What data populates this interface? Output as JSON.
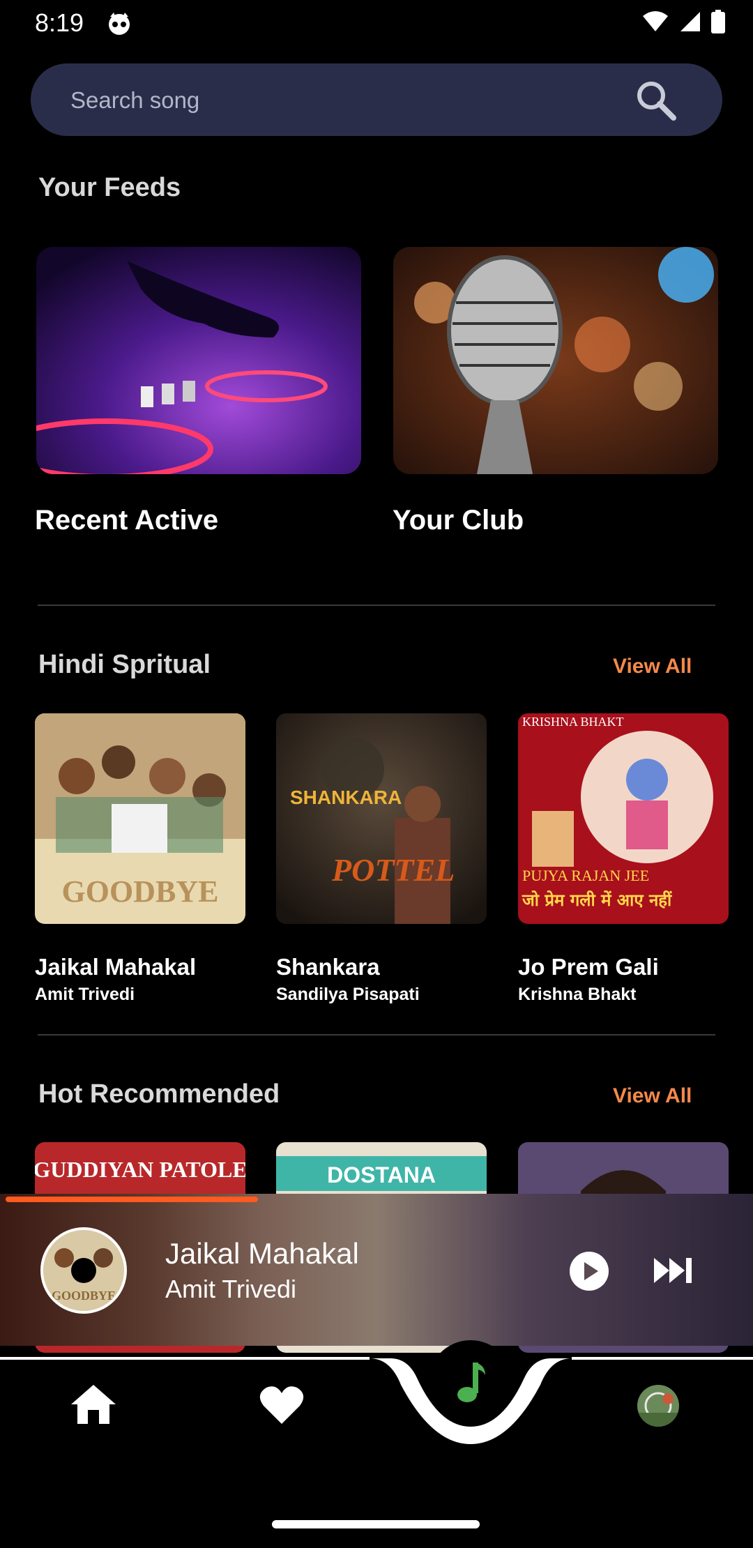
{
  "status_bar": {
    "time": "8:19"
  },
  "search": {
    "placeholder": "Search song"
  },
  "feeds": {
    "title": "Your Feeds",
    "cards": [
      {
        "label": "Recent Active"
      },
      {
        "label": "Your Club"
      }
    ]
  },
  "hindi_spiritual": {
    "title": "Hindi Spritual",
    "view_all": "View All",
    "items": [
      {
        "title": "Jaikal Mahakal",
        "artist": "Amit Trivedi",
        "cover_text": "GOODBYE"
      },
      {
        "title": "Shankara",
        "artist": "Sandilya Pisapati",
        "cover_text": "SHANKARA",
        "cover_sub": "POTTEL"
      },
      {
        "title": "Jo Prem Gali",
        "artist": "Krishna Bhakt",
        "cover_text": "PUJYA RAJAN JEE",
        "cover_top": "KRISHNA BHAKT",
        "cover_hindi": "जो प्रेम गली में आए नहीं"
      }
    ]
  },
  "hot_recommended": {
    "title": "Hot Recommended",
    "view_all": "View All",
    "items": [
      {
        "cover_text": "GUDDIYAN PATOLE"
      },
      {
        "cover_text": "DOSTANA"
      },
      {
        "cover_text": ""
      }
    ]
  },
  "player": {
    "title": "Jaikal Mahakal",
    "artist": "Amit Trivedi",
    "progress": 0.34,
    "disc_text": "GOODBYE",
    "accent": "#ff5a1f"
  },
  "nav": {
    "items": [
      "home-icon",
      "heart-icon",
      "music-note-icon",
      "avatar"
    ],
    "accent": "#4caf50"
  }
}
